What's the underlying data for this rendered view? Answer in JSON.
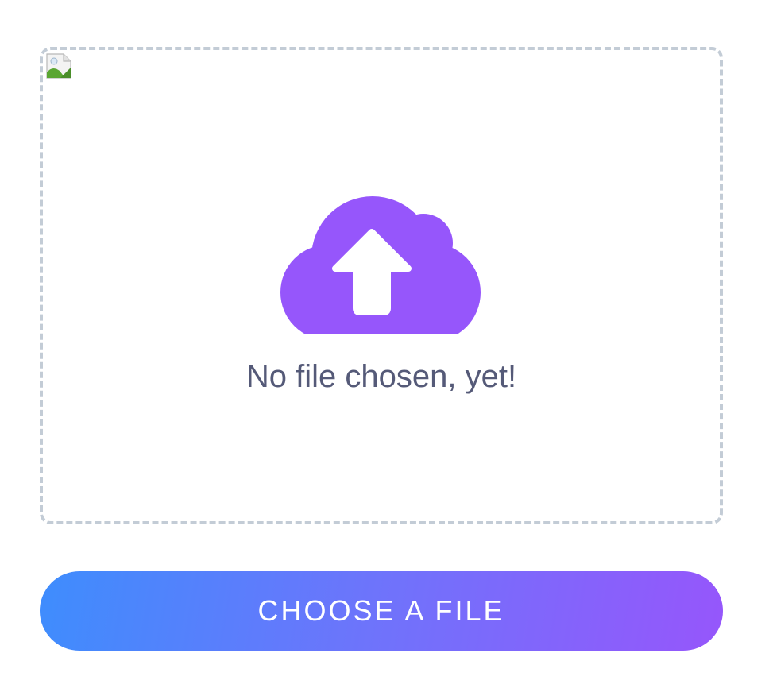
{
  "upload": {
    "status_text": "No file chosen, yet!",
    "preview_icon": "broken-image-icon",
    "main_icon": "cloud-upload-icon",
    "accent_color": "#9656fb",
    "border_color": "#c3ccd6",
    "text_color": "#555a78"
  },
  "button": {
    "label": "CHOOSE A FILE",
    "gradient_start": "#3e8dfd",
    "gradient_end": "#9656fb"
  }
}
